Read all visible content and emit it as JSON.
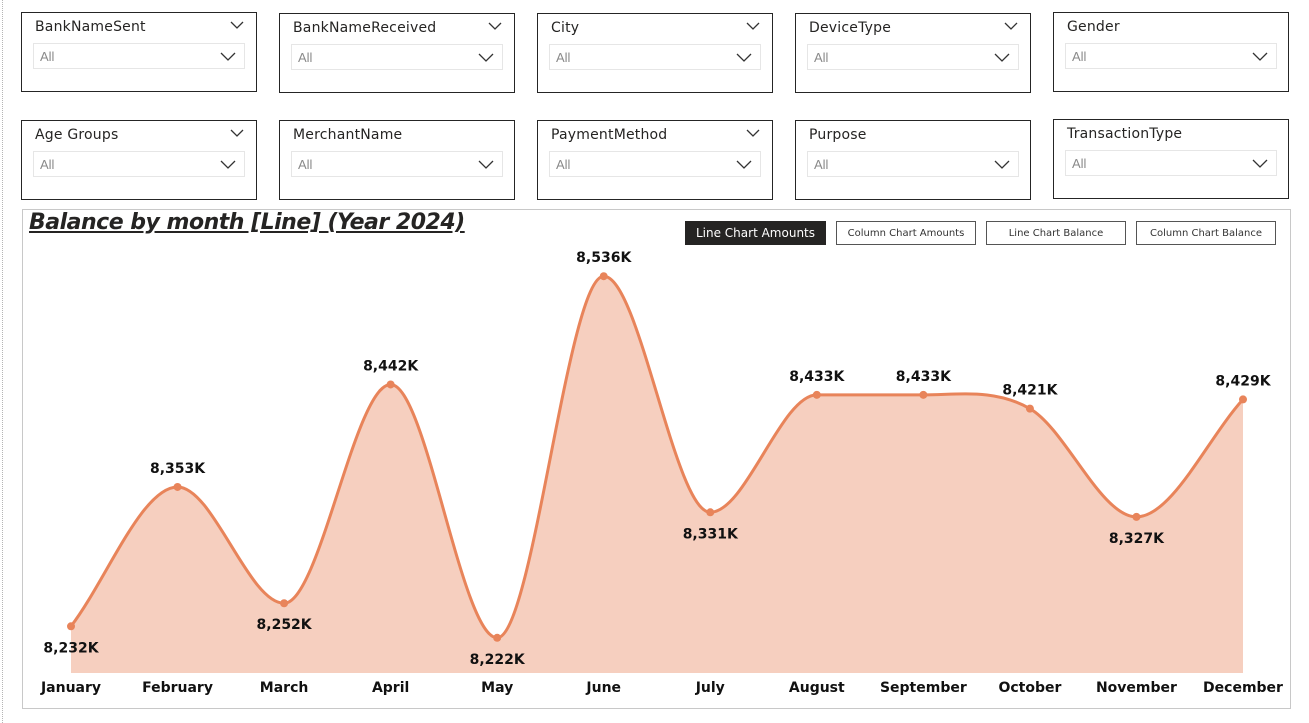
{
  "slicers": [
    {
      "label": "BankNameSent",
      "value": "All"
    },
    {
      "label": "BankNameReceived",
      "value": "All"
    },
    {
      "label": "City",
      "value": "All"
    },
    {
      "label": "DeviceType",
      "value": "All"
    },
    {
      "label": "Gender",
      "value": "All"
    },
    {
      "label": "Age Groups",
      "value": "All"
    },
    {
      "label": "MerchantName",
      "value": "All"
    },
    {
      "label": "PaymentMethod",
      "value": "All"
    },
    {
      "label": "Purpose",
      "value": "All"
    },
    {
      "label": "TransactionType",
      "value": "All"
    }
  ],
  "buttons": {
    "line_amounts": "Line Chart Amounts",
    "column_amounts": "Column Chart Amounts",
    "line_balance": "Line Chart Balance",
    "column_balance": "Column Chart Balance"
  },
  "colors": {
    "line": "#e8845a",
    "area": "#f6cfbf",
    "active_button": "#252423"
  },
  "chart_data": {
    "type": "area",
    "title": "Balance by month [Line] (Year 2024)",
    "categories": [
      "January",
      "February",
      "March",
      "April",
      "May",
      "June",
      "July",
      "August",
      "September",
      "October",
      "November",
      "December"
    ],
    "values": [
      8232,
      8353,
      8252,
      8442,
      8222,
      8536,
      8331,
      8433,
      8433,
      8421,
      8327,
      8429
    ],
    "labels": [
      "8,232K",
      "8,353K",
      "8,252K",
      "8,442K",
      "8,222K",
      "8,536K",
      "8,331K",
      "8,433K",
      "8,433K",
      "8,421K",
      "8,327K",
      "8,429K"
    ],
    "value_unit": "K",
    "ylim": [
      8214,
      8544
    ],
    "grid": false,
    "legend": "none"
  }
}
